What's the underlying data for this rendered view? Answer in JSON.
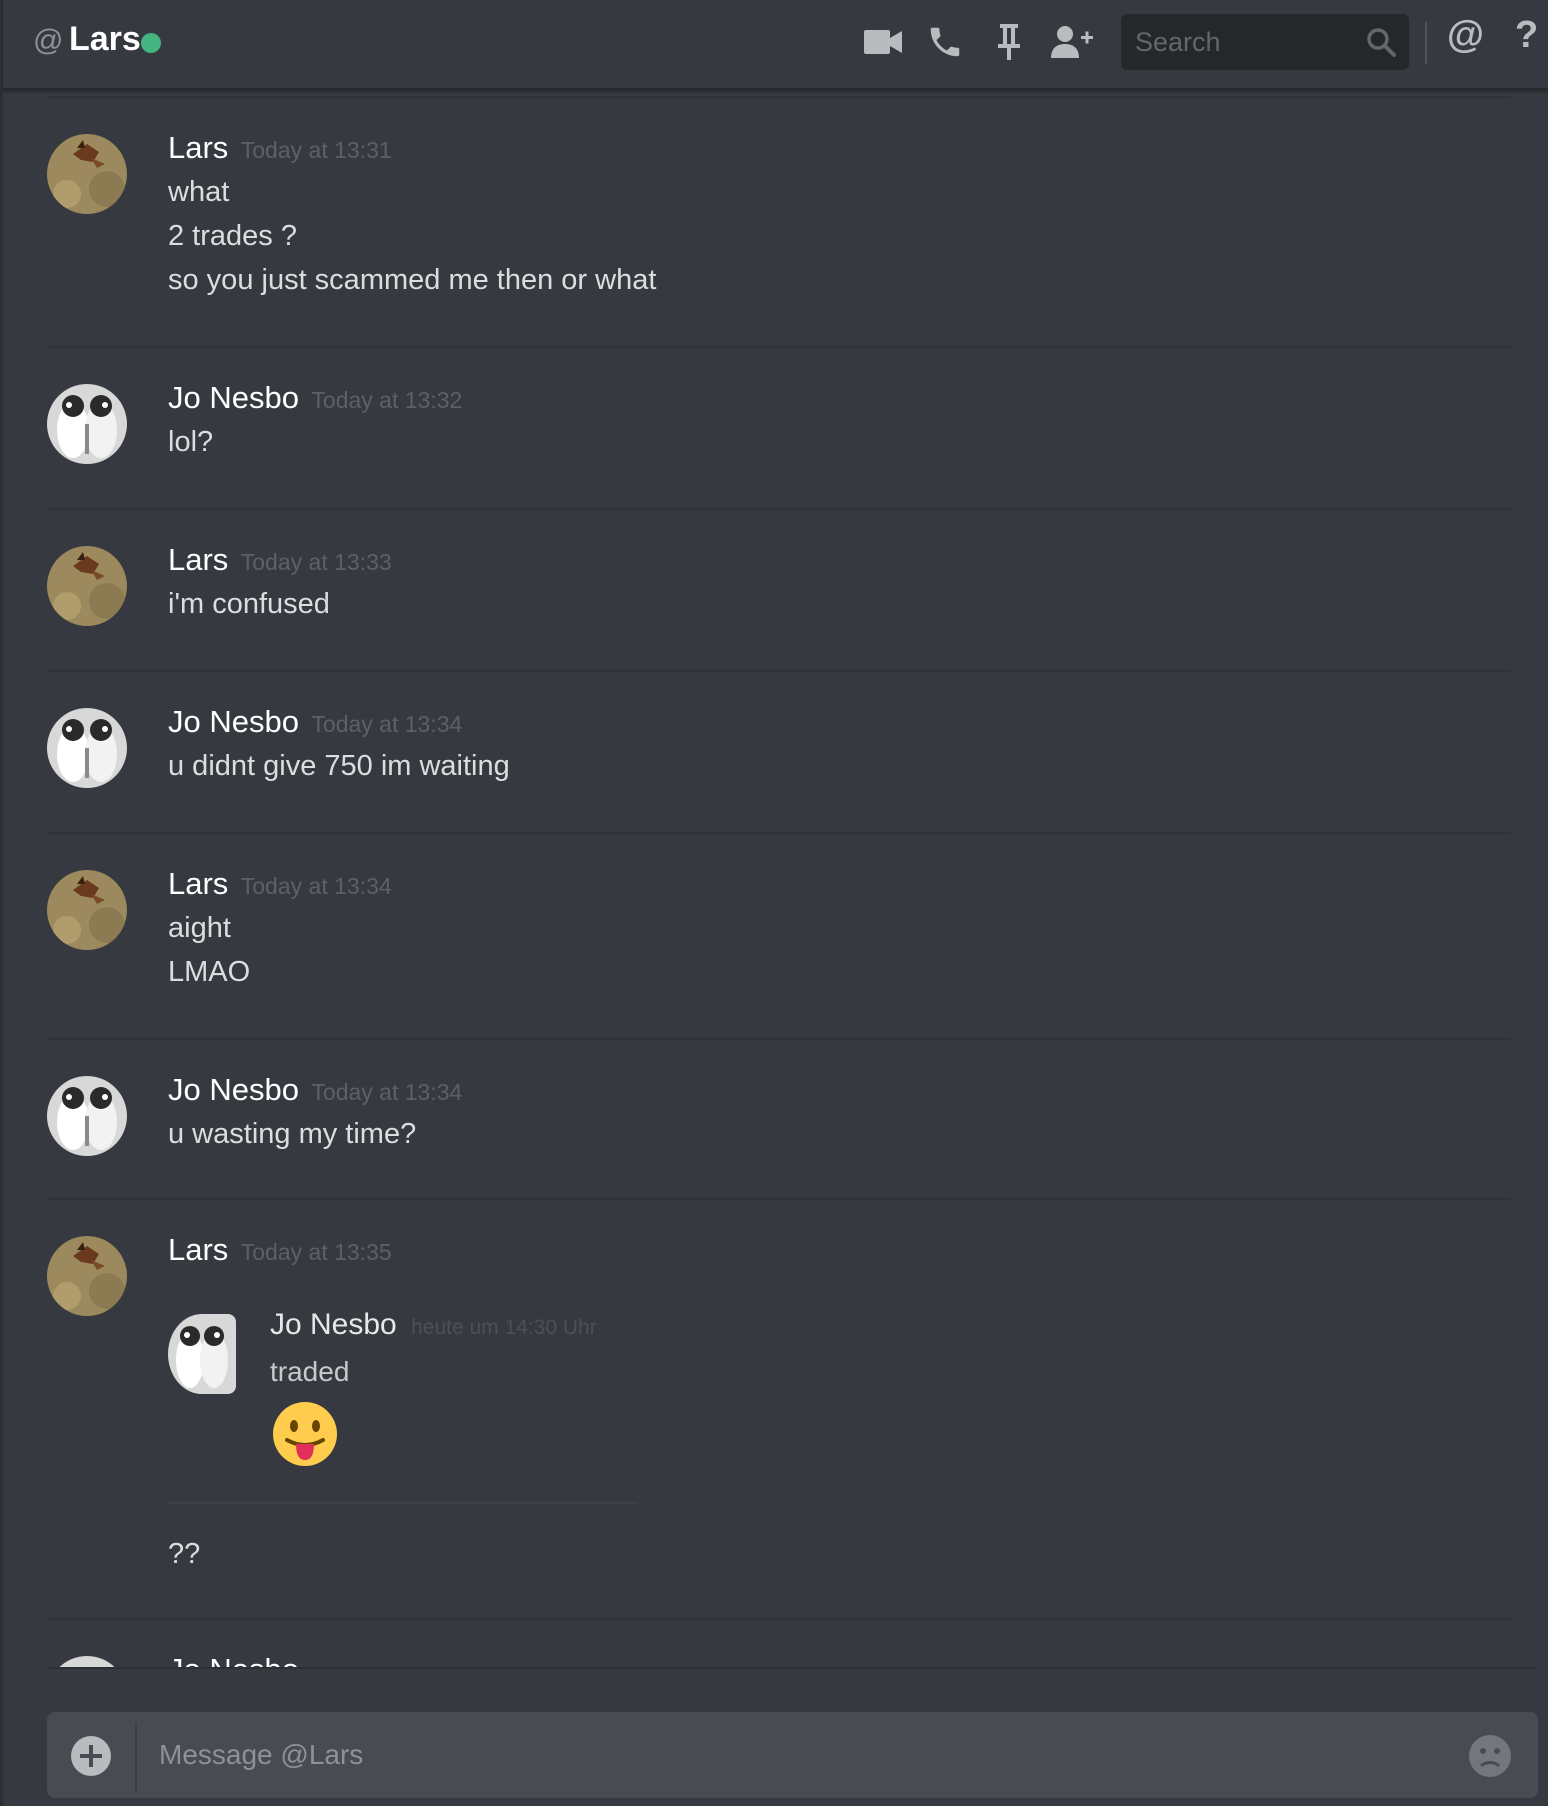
{
  "header": {
    "at_symbol": "@",
    "channel_name": "Lars",
    "status": "online",
    "status_color": "#43b581",
    "icons": [
      "video-camera-icon",
      "phone-icon",
      "pin-icon",
      "add-friend-icon",
      "mention-icon",
      "help-icon"
    ],
    "search": {
      "placeholder": "Search"
    },
    "mention_glyph": "@",
    "help_glyph": "?"
  },
  "messages": [
    {
      "author": "Lars",
      "timestamp": "Today at 13:31",
      "lines": [
        "what",
        "2 trades ?",
        "so you just scammed me then or what"
      ]
    },
    {
      "author": "Jo Nesbo",
      "timestamp": "Today at 13:32",
      "lines": [
        "lol?"
      ]
    },
    {
      "author": "Lars",
      "timestamp": "Today at 13:33",
      "lines": [
        "i'm confused"
      ]
    },
    {
      "author": "Jo Nesbo",
      "timestamp": "Today at 13:34",
      "lines": [
        "u didnt give 750 im waiting"
      ]
    },
    {
      "author": "Lars",
      "timestamp": "Today at 13:34",
      "lines": [
        "aight",
        "LMAO"
      ]
    },
    {
      "author": "Jo Nesbo",
      "timestamp": "Today at 13:34",
      "lines": [
        "u wasting my time?"
      ]
    },
    {
      "author": "Lars",
      "timestamp": "Today at 13:35",
      "quote": {
        "author": "Jo Nesbo",
        "timestamp": "heute um 14:30 Uhr",
        "text": "traded",
        "emoji": "tongue-out-emoji"
      },
      "lines": [
        "??"
      ]
    },
    {
      "author": "Jo Nesbo",
      "timestamp": "",
      "lines": []
    }
  ],
  "composer": {
    "placeholder": "Message @Lars",
    "icons": [
      "add-attachment-icon",
      "emoji-picker-icon"
    ]
  }
}
